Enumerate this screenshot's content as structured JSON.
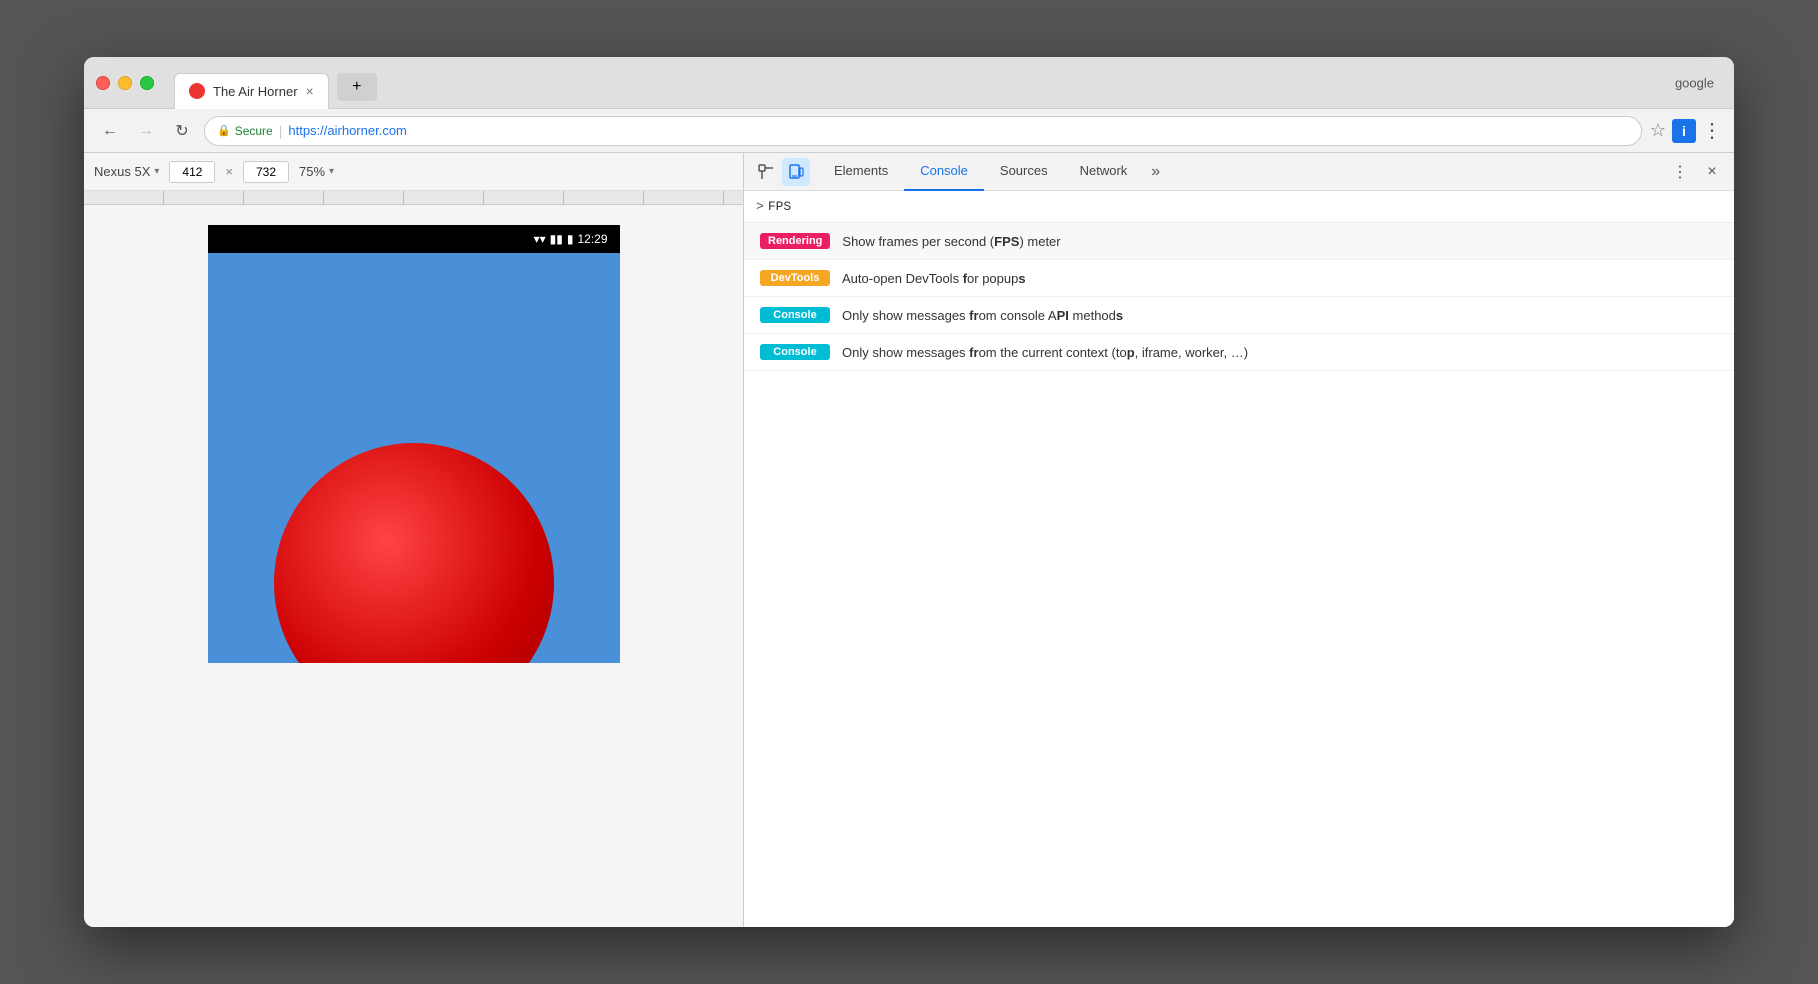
{
  "browser": {
    "traffic_lights": [
      "close",
      "minimize",
      "maximize"
    ],
    "tab": {
      "title": "The Air Horner",
      "favicon_color": "#dd3333",
      "close_label": "×"
    },
    "new_tab_label": "+",
    "google_text": "google",
    "nav": {
      "back_label": "←",
      "forward_label": "→",
      "refresh_label": "↻",
      "secure_label": "Secure",
      "url": "https://airhorner.com",
      "star_label": "☆",
      "extension_label": "i",
      "menu_label": "⋮"
    }
  },
  "device_toolbar": {
    "device_name": "Nexus 5X",
    "width": "412",
    "height": "732",
    "zoom": "75%",
    "x_sep": "×"
  },
  "mobile": {
    "status_bar": {
      "time": "12:29",
      "wifi_icon": "▾",
      "signal_icon": "▾",
      "battery_icon": "▮"
    }
  },
  "devtools": {
    "tabs": [
      {
        "label": "Elements",
        "active": false
      },
      {
        "label": "Console",
        "active": true
      },
      {
        "label": "Sources",
        "active": false
      },
      {
        "label": "Network",
        "active": false
      }
    ],
    "more_label": "»",
    "menu_label": "⋮",
    "close_label": "×",
    "inspect_icon": "⊡",
    "device_icon": "📱"
  },
  "console": {
    "prompt": ">",
    "input_text": "FPS",
    "autocomplete_items": [
      {
        "badge": "Rendering",
        "badge_class": "badge-rendering",
        "text_parts": [
          {
            "text": "Show frames per second (",
            "bold": false
          },
          {
            "text": "FPS",
            "bold": true
          },
          {
            "text": ") meter",
            "bold": false
          }
        ],
        "full_text": "Show frames per second (FPS) meter"
      },
      {
        "badge": "DevTools",
        "badge_class": "badge-devtools",
        "text_parts": [
          {
            "text": "Auto-open DevTools ",
            "bold": false
          },
          {
            "text": "f",
            "bold": true
          },
          {
            "text": "or popup",
            "bold": false
          },
          {
            "text": "s",
            "bold": true
          }
        ],
        "full_text": "Auto-open DevTools for popups"
      },
      {
        "badge": "Console",
        "badge_class": "badge-console",
        "text_parts": [
          {
            "text": "Only show messages ",
            "bold": false
          },
          {
            "text": "fr",
            "bold": true
          },
          {
            "text": "om console A",
            "bold": false
          },
          {
            "text": "PI",
            "bold": true
          },
          {
            "text": " method",
            "bold": false
          },
          {
            "text": "s",
            "bold": true
          }
        ],
        "full_text": "Only show messages from console API methods"
      },
      {
        "badge": "Console",
        "badge_class": "badge-console",
        "text_parts": [
          {
            "text": "Only show messages ",
            "bold": false
          },
          {
            "text": "fr",
            "bold": true
          },
          {
            "text": "om the current context (to",
            "bold": false
          },
          {
            "text": "p",
            "bold": true
          },
          {
            "text": ", iframe, worker, …",
            "bold": false
          }
        ],
        "full_text": "Only show messages from the current context (top, iframe, worker, …)"
      }
    ]
  }
}
